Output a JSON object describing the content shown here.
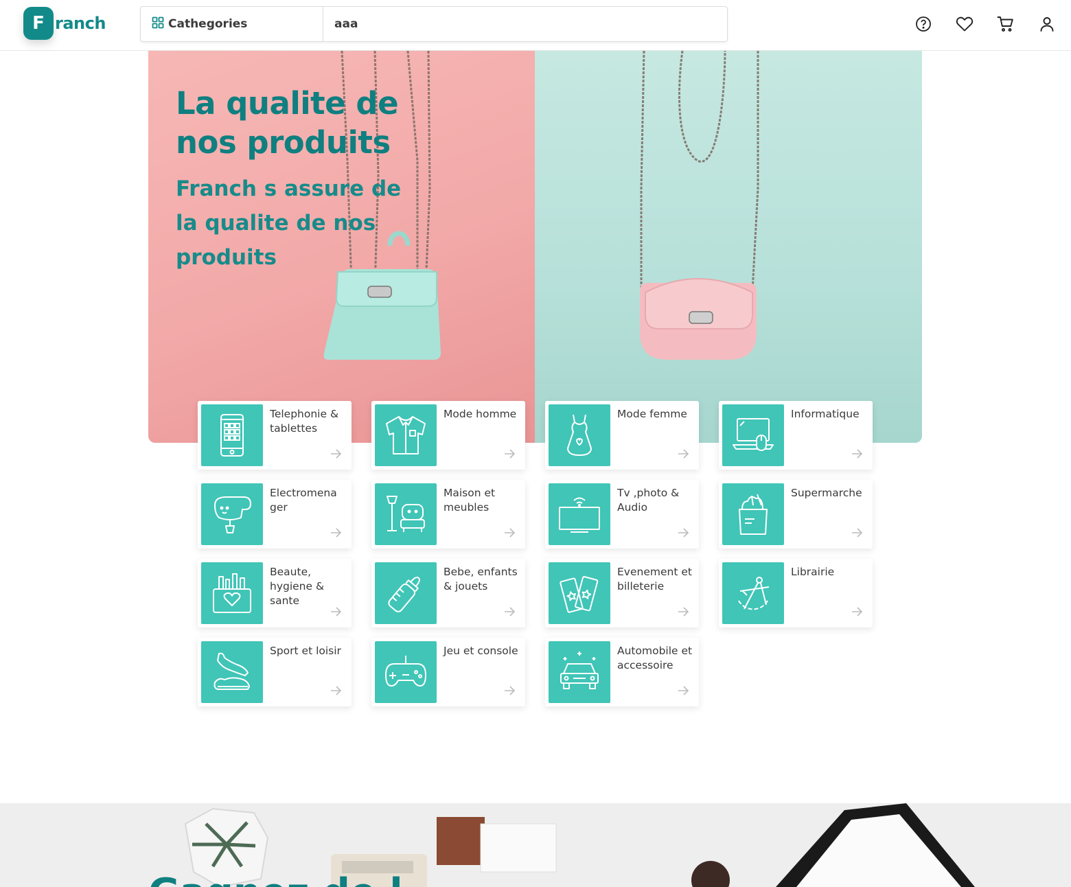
{
  "brand": {
    "badge": "F",
    "name": "ranch"
  },
  "search": {
    "categories_label": "Cathegories",
    "value": "aaa"
  },
  "header_icons": [
    "help-icon",
    "heart-icon",
    "cart-icon",
    "user-icon"
  ],
  "hero": {
    "title": "La qualite de nos produits",
    "subtitle": "Franch s assure de la qualite de nos produits"
  },
  "categories": [
    {
      "label": "Telephonie & tablettes",
      "icon": "phone-icon"
    },
    {
      "label": "Mode homme",
      "icon": "shirt-icon"
    },
    {
      "label": "Mode femme",
      "icon": "dress-icon"
    },
    {
      "label": "Informatique",
      "icon": "laptop-icon"
    },
    {
      "label": "Electromena ger",
      "icon": "mixer-icon"
    },
    {
      "label": "Maison et meubles",
      "icon": "furniture-icon"
    },
    {
      "label": "Tv ,photo & Audio",
      "icon": "tv-icon"
    },
    {
      "label": "Supermarche",
      "icon": "grocery-bag-icon"
    },
    {
      "label": "Beaute, hygiene & sante",
      "icon": "beauty-icon"
    },
    {
      "label": "Bebe, enfants & jouets",
      "icon": "baby-bottle-icon"
    },
    {
      "label": "Evenement et billeterie",
      "icon": "ticket-icon"
    },
    {
      "label": "Librairie",
      "icon": "compass-icon"
    },
    {
      "label": "Sport et loisir",
      "icon": "sneaker-icon"
    },
    {
      "label": "Jeu et console",
      "icon": "gamepad-icon"
    },
    {
      "label": "Automobile et accessoire",
      "icon": "car-icon"
    }
  ],
  "banner": {
    "partial_text": "Gagnez de l"
  },
  "colors": {
    "brand": "#138a8a",
    "tile": "#40c5b7",
    "hero_pink": "#f2a9a8",
    "hero_mint": "#b6e0d9"
  }
}
